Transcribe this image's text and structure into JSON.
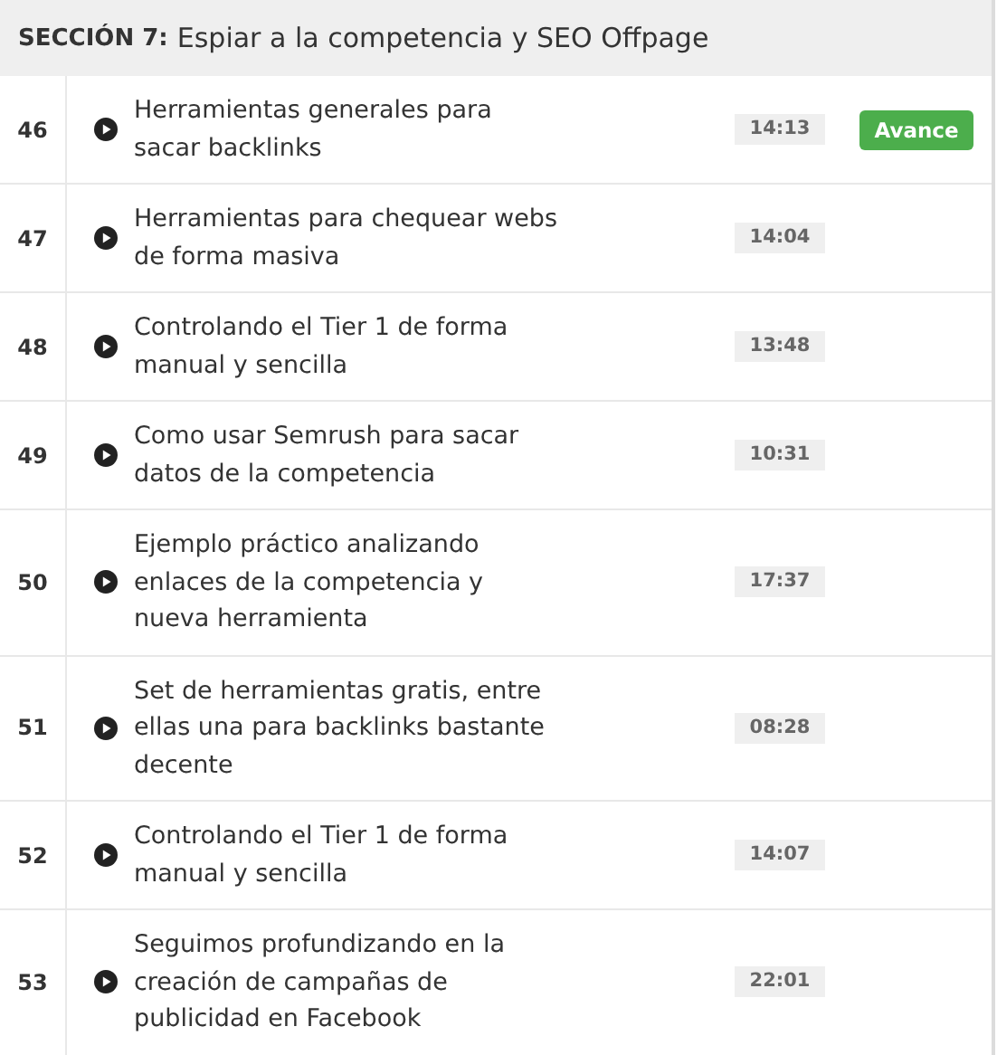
{
  "section": {
    "label": "SECCIÓN 7:",
    "title": "Espiar a la competencia y SEO Offpage"
  },
  "lessons": [
    {
      "number": "46",
      "title": "Herramientas generales para sacar backlinks",
      "duration": "14:13",
      "badge": "Avance"
    },
    {
      "number": "47",
      "title": "Herramientas para chequear webs de forma masiva",
      "duration": "14:04"
    },
    {
      "number": "48",
      "title": "Controlando el Tier 1 de forma manual y sencilla",
      "duration": "13:48"
    },
    {
      "number": "49",
      "title": "Como usar Semrush para sacar datos de la competencia",
      "duration": "10:31"
    },
    {
      "number": "50",
      "title": "Ejemplo práctico analizando enlaces de la competencia y nueva herramienta",
      "duration": "17:37"
    },
    {
      "number": "51",
      "title": "Set de herramientas gratis, entre ellas una para backlinks bastante decente",
      "duration": "08:28"
    },
    {
      "number": "52",
      "title": "Controlando el Tier 1 de forma manual y sencilla",
      "duration": "14:07"
    },
    {
      "number": "53",
      "title": "Seguimos profundizando en la creación de campañas de publicidad en Facebook",
      "duration": "22:01"
    }
  ]
}
